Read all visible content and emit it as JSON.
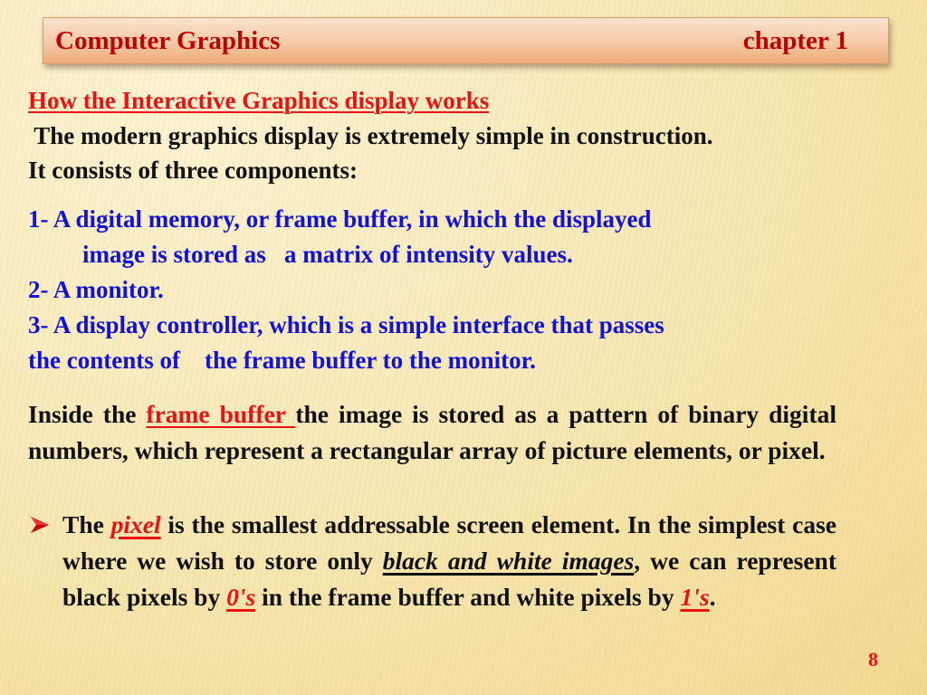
{
  "header": {
    "title": "Computer Graphics",
    "chapter": "chapter 1"
  },
  "heading": "How the Interactive Graphics display works",
  "intro": {
    "line1": " The modern graphics display is extremely simple in construction.",
    "line2": "It consists of three components:"
  },
  "components": {
    "item1_line1": "1- A digital memory, or frame buffer, in which the displayed",
    "item1_line2": "image is stored as   a matrix of intensity values.",
    "item2": "2- A monitor.",
    "item3_line1": "3- A display controller, which is a simple interface that passes",
    "item3_line2": "the contents of    the frame buffer to the monitor."
  },
  "frame_buffer_paragraph": {
    "prefix": "Inside the ",
    "highlight": "frame buffer ",
    "suffix": "the image is stored as a pattern of binary digital numbers, which represent a rectangular array of picture elements, or pixel."
  },
  "bullet": {
    "icon": "arrowhead-bullet-icon",
    "part1": "The ",
    "pixel": "pixel",
    "part2": " is the smallest addressable screen element. In the simplest case where we wish to store only ",
    "bw": "black and white images",
    "part3": ", we can represent black pixels by ",
    "zeros": "0's",
    "part4": " in the frame buffer and white pixels by ",
    "ones": "1's",
    "part5": "."
  },
  "page_number": "8",
  "colors": {
    "header_text": "#c00000",
    "heading_red": "#ee1111",
    "list_blue": "#1010e0",
    "body_black": "#111111"
  }
}
